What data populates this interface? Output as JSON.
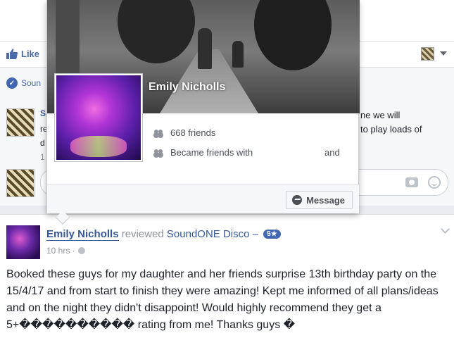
{
  "feed": {
    "like_label": "Like",
    "comment_page_fragment": "Soun",
    "comment1": {
      "name_fragment": "S",
      "line2_fragment": "re",
      "line3_fragment": "d",
      "time_fragment": "1",
      "text_right": "ne we will\nto play loads of"
    }
  },
  "hover_card": {
    "name": "Emily Nicholls",
    "friends_count": "668 friends",
    "became_friends": "Became friends with",
    "and_text": "and",
    "message_label": "Message"
  },
  "post": {
    "author": "Emily Nicholls",
    "verb": "reviewed",
    "page": "SoundONE Disco –",
    "rating": "5★",
    "time": "10 hrs ·",
    "text": "Booked these guys for my daughter and her friends surprise 13th birthday party on the 15/4/17 and from start to finish they were amazing! Kept me informed of all plans/ideas and on the night they didn't disappoint! Would highly recommend they get a 5+���������� rating from me! Thanks guys �"
  },
  "icons": [
    "like-icon",
    "dropdown-caret-icon",
    "friends-icon",
    "messenger-icon",
    "camera-icon",
    "emoji-icon",
    "globe-icon",
    "chevron-down-icon"
  ]
}
